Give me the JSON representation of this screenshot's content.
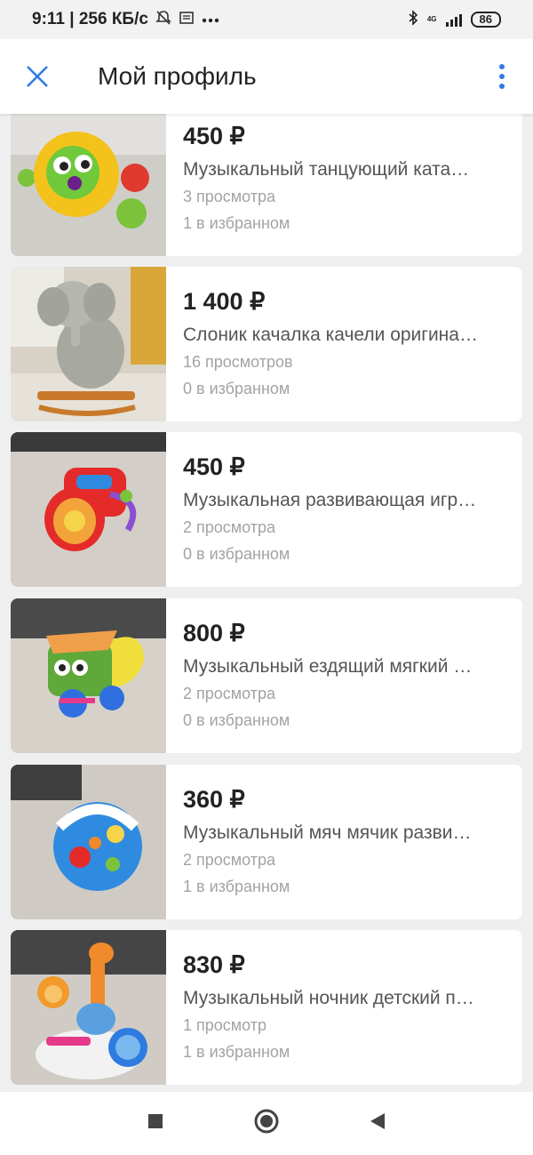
{
  "status": {
    "time_speed": "9:11 | 256 КБ/с",
    "network": "4G",
    "battery": "86"
  },
  "header": {
    "title": "Мой профиль"
  },
  "listings": [
    {
      "price": "450 ₽",
      "name": "Музыкальный танцующий ката…",
      "views": "3 просмотра",
      "favs": "1 в избранном"
    },
    {
      "price": "1 400 ₽",
      "name": "Слоник качалка качели оригина…",
      "views": "16 просмотров",
      "favs": "0 в избранном"
    },
    {
      "price": "450 ₽",
      "name": "Музыкальная развивающая игр…",
      "views": "2 просмотра",
      "favs": "0 в избранном"
    },
    {
      "price": "800 ₽",
      "name": "Музыкальный ездящий мягкий …",
      "views": "2 просмотра",
      "favs": "0 в избранном"
    },
    {
      "price": "360 ₽",
      "name": "Музыкальный мяч мячик разви…",
      "views": "2 просмотра",
      "favs": "1 в избранном"
    },
    {
      "price": "830 ₽",
      "name": "Музыкальный ночник детский п…",
      "views": "1 просмотр",
      "favs": "1 в избранном"
    }
  ],
  "colors": {
    "accent": "#2f7be6",
    "muted": "#a3a3a3"
  },
  "icons": {
    "close": "close-icon",
    "more": "more-vertical-icon",
    "nav_recents": "square-icon",
    "nav_home": "circle-icon",
    "nav_back": "triangle-back-icon"
  }
}
